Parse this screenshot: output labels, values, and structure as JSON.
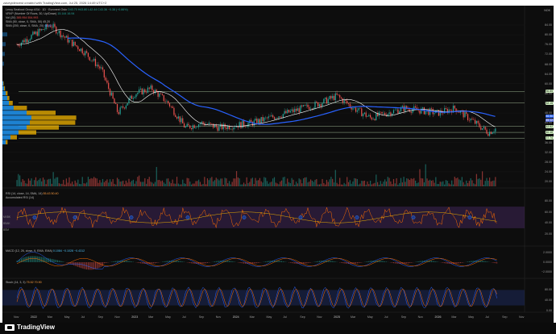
{
  "caption": "zaveyidimvest created with TradingView.com, Jul 25, 2026 14:49 UTC+2",
  "currency": "NOK",
  "legend": {
    "symbol_line": "Leroy Seafood Group ASA · 1D · Euronext Oslo",
    "ohlc": "O43.70 H43.80 L42.44 C43.36 −0.38 (−0.86%)",
    "vrvp": "VRVP (Number Of Rows, 30, Up/Down)",
    "vrvp_vals": "15.144  16.94",
    "vol": "Vol (20)",
    "vol_vals": "385.954  554.993",
    "sma50": "SMA (50, close, 0, SMA, 50)",
    "sma50_val": "45.20",
    "sma200": "SMA (200, close, 0, SMA, 20)",
    "sma200_val": "46.90",
    "rsi": "RSI (14, close, 14, SMA, 14)",
    "rsi_vals": "55.43  50.40",
    "rsi_sub": "Accumulated RSI (14)",
    "macd": "MACD (12, 26, close, 9, EMA, EMA)",
    "macd_vals": "0.1084  −0.1028  −0.4312",
    "stoch": "Stoch (14, 3, 3)",
    "stoch_vals": "75.52  70.90"
  },
  "price_axis": [
    "84.00",
    "80.00",
    "76.00",
    "72.00",
    "68.00",
    "64.00",
    "60.00",
    "56.00",
    "52.00",
    "48.00",
    "44.00",
    "40.00",
    "36.00",
    "32.00",
    "28.00",
    "24.00",
    "20.00"
  ],
  "price_tags": [
    {
      "text": "56.85",
      "color": "#d4f3c4"
    },
    {
      "text": "52.15",
      "color": "#d4f3c4"
    },
    {
      "text": "46.56",
      "color": "#2962ff"
    },
    {
      "text": "45.12",
      "color": "#5b6fd8"
    },
    {
      "text": "42.52",
      "color": "#d4f3c4"
    },
    {
      "text": "40.10",
      "color": "#d4f3c4"
    },
    {
      "text": "37.74",
      "color": "#d4f3c4"
    }
  ],
  "rsi_axis": [
    "80.00",
    "60.00",
    "40.00",
    "20.00"
  ],
  "rsi_tags": [
    "MXBK",
    "BSAK",
    "BSM"
  ],
  "macd_axis": [
    "2.0000",
    "0.0000",
    "−2.0000"
  ],
  "stoch_axis": [
    "80.00",
    "40.00",
    "0.00"
  ],
  "time_axis": [
    "Nov",
    "2022",
    "Mar",
    "May",
    "Jul",
    "Sep",
    "Nov",
    "2023",
    "Mar",
    "May",
    "Jul",
    "Sep",
    "Nov",
    "2024",
    "Mar",
    "May",
    "Jul",
    "Sep",
    "Nov",
    "2025",
    "Mar",
    "May",
    "Jul",
    "Sep",
    "Nov",
    "2026",
    "Mar",
    "May",
    "Jul",
    "Sep",
    "Nov"
  ],
  "brand": "TradingView",
  "colors": {
    "background": "#0d0d0d",
    "sma50": "#ffffff",
    "sma200": "#2962ff",
    "up": "#26a69a",
    "down": "#ef5350",
    "vrvp_up": "#2196f3",
    "vrvp_down": "#f2b400",
    "rsi": "#ff6d00",
    "rsi_band": "#4a2a66"
  }
}
